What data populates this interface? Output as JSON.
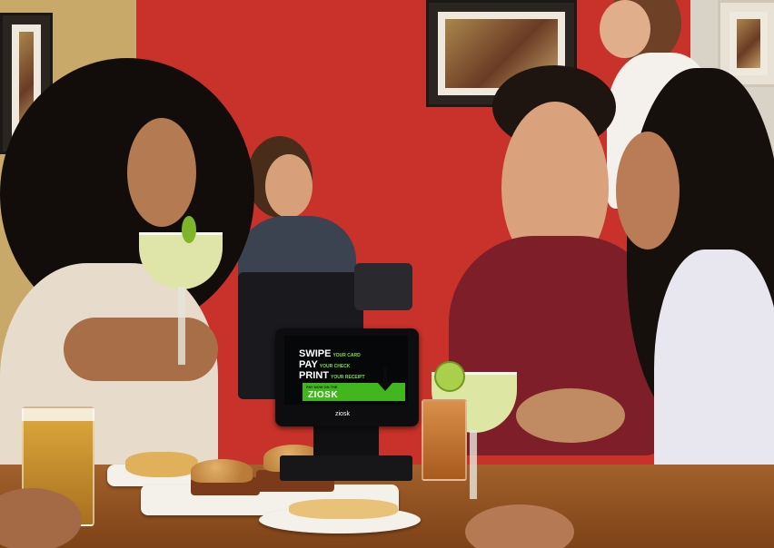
{
  "photo": {
    "kiosk": {
      "line1_main": "SWIPE",
      "line1_sub": "YOUR CARD",
      "line2_main": "PAY",
      "line2_sub": "YOUR CHECK",
      "line3_main": "PRINT",
      "line3_sub": "YOUR RECEIPT",
      "bar_small": "PAY NOW ON THE",
      "bar_brand": "ZIOSK",
      "device_brand": "ziosk"
    },
    "colors": {
      "wall": "#c8322a",
      "kiosk_green": "#41b61f",
      "table": "#8e4f21"
    }
  }
}
